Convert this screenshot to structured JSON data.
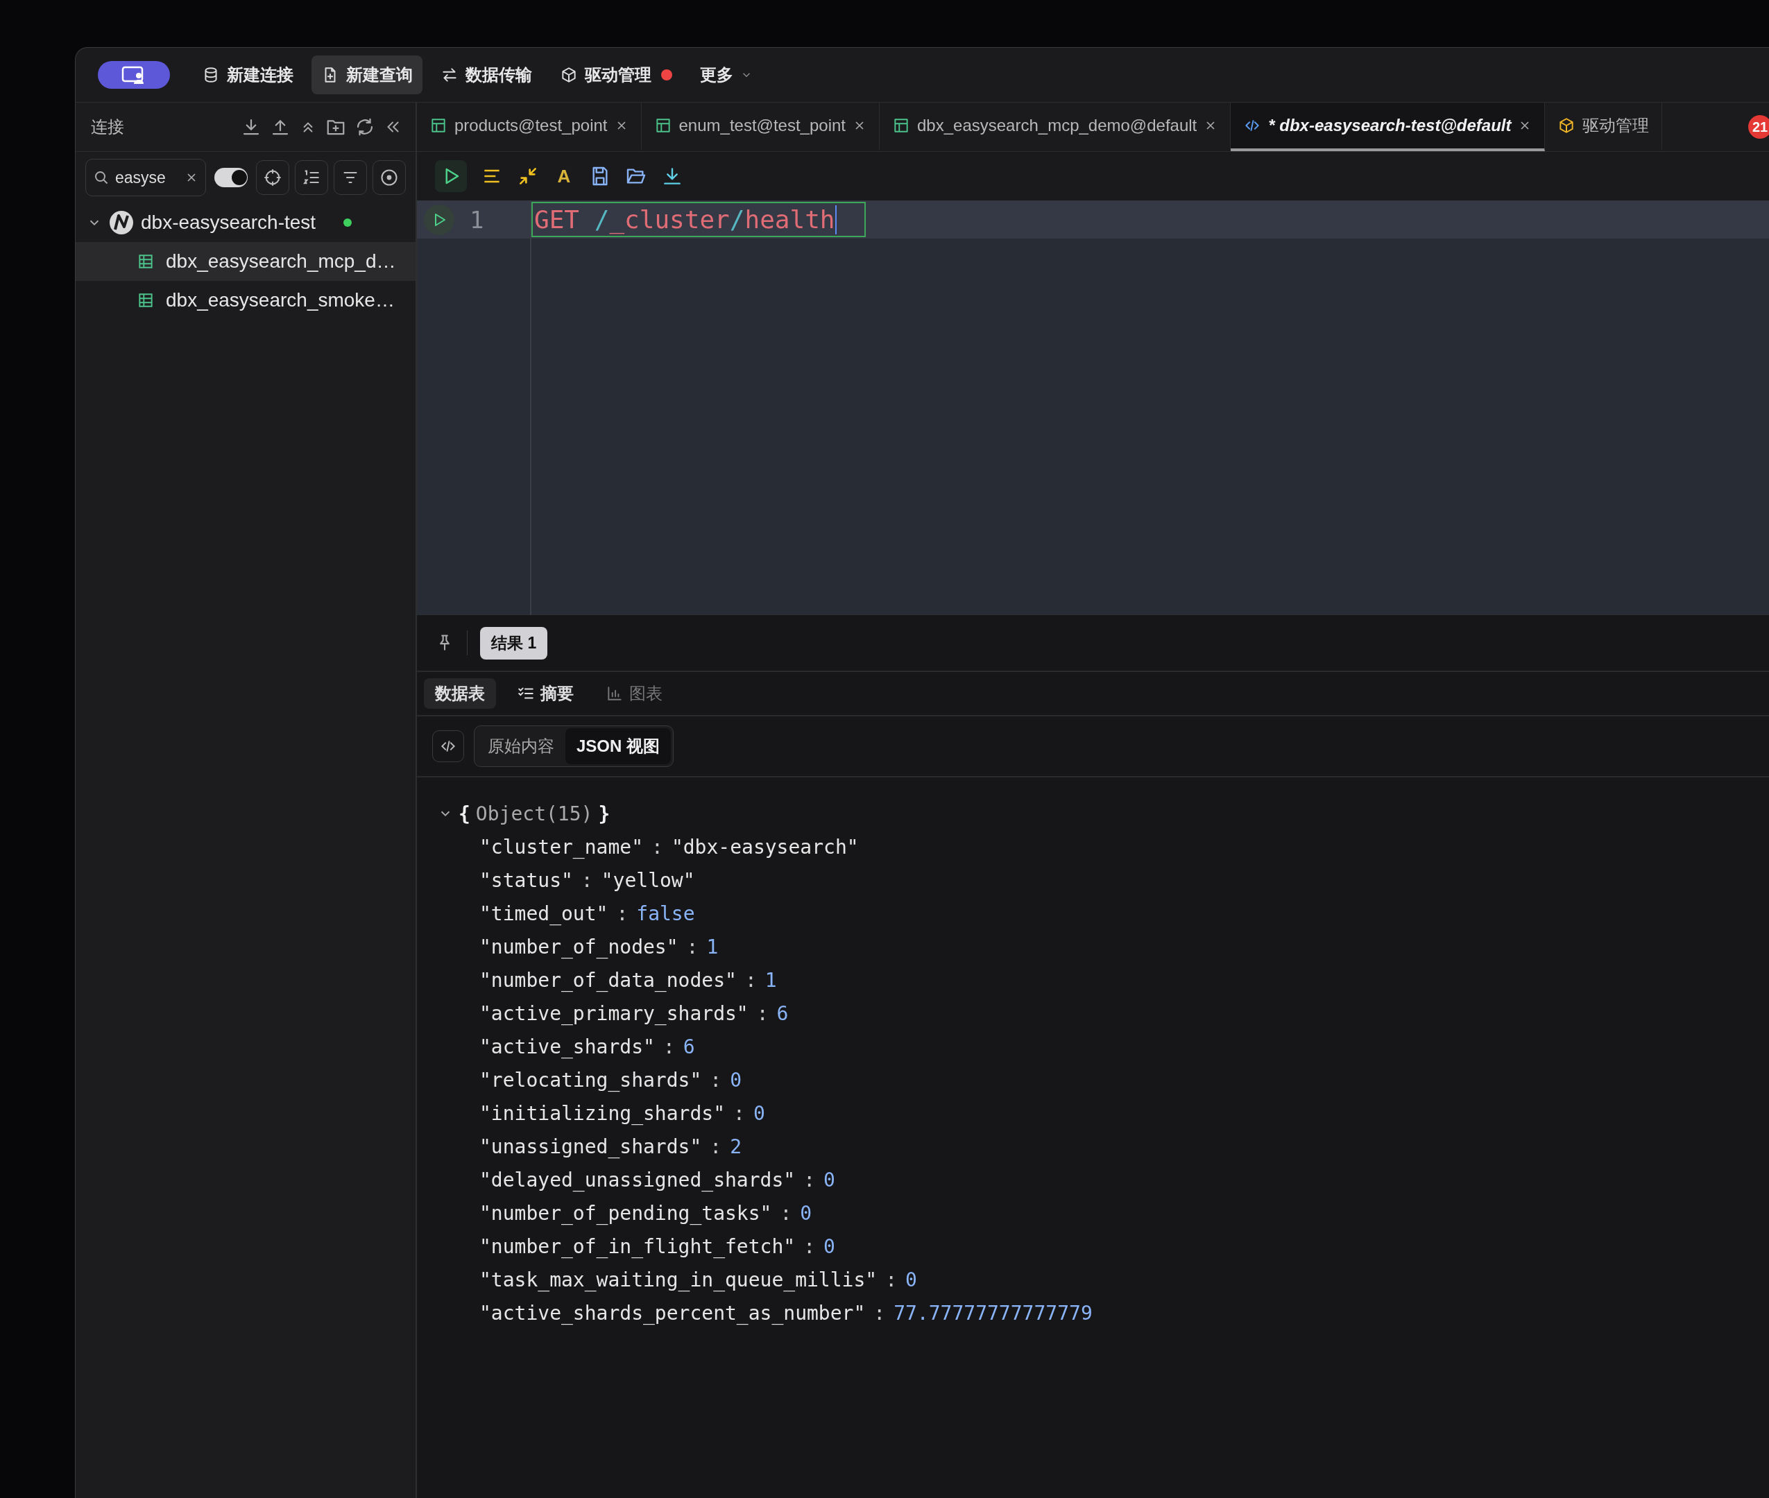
{
  "toolbar": {
    "buttons": [
      {
        "label": "新建连接",
        "kind": "connection",
        "selected": false,
        "alert": false
      },
      {
        "label": "新建查询",
        "kind": "query",
        "selected": true,
        "alert": false
      },
      {
        "label": "数据传输",
        "kind": "transfer",
        "selected": false,
        "alert": false
      },
      {
        "label": "驱动管理",
        "kind": "driver",
        "selected": false,
        "alert": true
      }
    ],
    "more": "更多"
  },
  "sidebar": {
    "title": "连接",
    "search": {
      "value": "easyse"
    },
    "toggle_on": true,
    "tree": [
      {
        "label": "dbx-easysearch-test",
        "expanded": true,
        "connected": true,
        "children": [
          {
            "label": "dbx_easysearch_mcp_d…",
            "selected": true
          },
          {
            "label": "dbx_easysearch_smoke…",
            "selected": false
          }
        ]
      }
    ]
  },
  "tabs": [
    {
      "label": "products@test_point",
      "kind": "table",
      "selected": false,
      "closable": true
    },
    {
      "label": "enum_test@test_point",
      "kind": "table",
      "selected": false,
      "closable": true
    },
    {
      "label": "dbx_easysearch_mcp_demo@default",
      "kind": "table",
      "selected": false,
      "closable": true
    },
    {
      "label": "* dbx-easysearch-test@default",
      "kind": "query",
      "selected": true,
      "closable": true
    },
    {
      "label": "驱动管理",
      "kind": "driver",
      "selected": false,
      "closable": false
    }
  ],
  "notification_count": "21",
  "editor": {
    "font_button": "A",
    "lines": [
      {
        "number": "1",
        "current": true,
        "tokens": [
          {
            "text": "GET ",
            "kind": "word"
          },
          {
            "text": "/",
            "kind": "punct"
          },
          {
            "text": "_cluster",
            "kind": "word"
          },
          {
            "text": "/",
            "kind": "punct"
          },
          {
            "text": "health",
            "kind": "word"
          }
        ]
      }
    ]
  },
  "results": {
    "tabs": [
      {
        "label": "结果 1",
        "selected": true
      }
    ],
    "view_tabs": [
      {
        "label": "数据表",
        "kind": "table",
        "selected": true,
        "disabled": false
      },
      {
        "label": "摘要",
        "kind": "summary",
        "selected": false,
        "disabled": false
      },
      {
        "label": "图表",
        "kind": "chart",
        "selected": false,
        "disabled": true
      }
    ],
    "format_toggle": [
      {
        "label": "原始内容",
        "selected": false
      },
      {
        "label": "JSON 视图",
        "selected": true
      }
    ],
    "json": {
      "expanded": true,
      "open": "{",
      "summary": "Object(15)",
      "close": "}",
      "entries": [
        {
          "key": "\"cluster_name\"",
          "sep": ":",
          "value": "\"dbx-easysearch\"",
          "kind": "string"
        },
        {
          "key": "\"status\"",
          "sep": ":",
          "value": "\"yellow\"",
          "kind": "string"
        },
        {
          "key": "\"timed_out\"",
          "sep": ":",
          "value": "false",
          "kind": "boolean"
        },
        {
          "key": "\"number_of_nodes\"",
          "sep": ":",
          "value": "1",
          "kind": "number"
        },
        {
          "key": "\"number_of_data_nodes\"",
          "sep": ":",
          "value": "1",
          "kind": "number"
        },
        {
          "key": "\"active_primary_shards\"",
          "sep": ":",
          "value": "6",
          "kind": "number"
        },
        {
          "key": "\"active_shards\"",
          "sep": ":",
          "value": "6",
          "kind": "number"
        },
        {
          "key": "\"relocating_shards\"",
          "sep": ":",
          "value": "0",
          "kind": "number"
        },
        {
          "key": "\"initializing_shards\"",
          "sep": ":",
          "value": "0",
          "kind": "number"
        },
        {
          "key": "\"unassigned_shards\"",
          "sep": ":",
          "value": "2",
          "kind": "number"
        },
        {
          "key": "\"delayed_unassigned_shards\"",
          "sep": ":",
          "value": "0",
          "kind": "number"
        },
        {
          "key": "\"number_of_pending_tasks\"",
          "sep": ":",
          "value": "0",
          "kind": "number"
        },
        {
          "key": "\"number_of_in_flight_fetch\"",
          "sep": ":",
          "value": "0",
          "kind": "number"
        },
        {
          "key": "\"task_max_waiting_in_queue_millis\"",
          "sep": ":",
          "value": "0",
          "kind": "number"
        },
        {
          "key": "\"active_shards_percent_as_number\"",
          "sep": ":",
          "value": "77.77777777777779",
          "kind": "number"
        }
      ]
    }
  }
}
